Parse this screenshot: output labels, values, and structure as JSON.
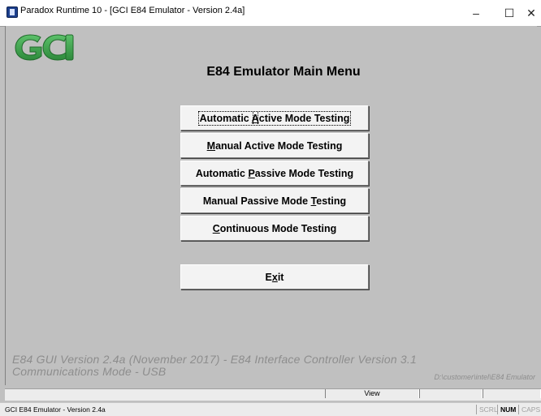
{
  "window": {
    "title": "Paradox Runtime 10 - [GCI E84 Emulator - Version 2.4a]",
    "minimize_glyph": "–",
    "maximize_glyph": "☐",
    "close_glyph": "✕"
  },
  "logo": {
    "text": "GCI",
    "color": "#3fa34d"
  },
  "main": {
    "heading": "E84 Emulator Main Menu",
    "buttons": [
      {
        "label": "Automatic Active Mode Testing",
        "pre": "Automatic ",
        "key": "A",
        "post": "ctive Mode Testing"
      },
      {
        "label": "Manual Active Mode Testing",
        "pre": "",
        "key": "M",
        "post": "anual Active Mode Testing"
      },
      {
        "label": "Automatic Passive Mode Testing",
        "pre": "Automatic ",
        "key": "P",
        "post": "assive Mode Testing"
      },
      {
        "label": "Manual Passive Mode Testing",
        "pre": "Manual Passive Mode ",
        "key": "T",
        "post": "esting"
      },
      {
        "label": "Continuous Mode Testing",
        "pre": "",
        "key": "C",
        "post": "ontinuous Mode Testing"
      },
      {
        "label": "Exit",
        "pre": "E",
        "key": "x",
        "post": "it"
      }
    ]
  },
  "footer": {
    "line1": "E84 GUI Version 2.4a (November 2017) - E84 Interface Controller Version 3.1",
    "line2": "Communications Mode - USB",
    "path": "D:\\customer\\intel\\E84 Emulator"
  },
  "statusbar": {
    "view": "View",
    "text": "GCI E84 Emulator - Version 2.4a",
    "scrl": "SCRL",
    "num": "NUM",
    "caps": "CAPS"
  }
}
